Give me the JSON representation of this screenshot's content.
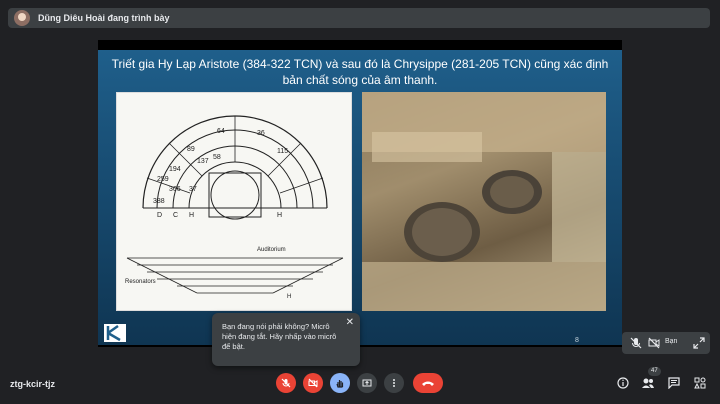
{
  "presenter": {
    "text": "Dũng Diêu Hoài đang trình bày"
  },
  "slide": {
    "title": "Triết gia Hy Lạp Aristote (384-322 TCN)  và sau đó là Chrysippe (281-205 TCN) cũng xác định bản chất sóng của âm thanh.",
    "page": "8"
  },
  "tooltip": {
    "text": "Bạn đang nói phải không? Micrô hiện đang tắt. Hãy nhấp vào micrô để bật."
  },
  "self_tile": {
    "name": "Bạn"
  },
  "meeting": {
    "code": "ztg-kcir-tjz",
    "participants": "47"
  },
  "icons": [
    "mic-off-icon",
    "camera-off-icon",
    "raise-hand-icon",
    "present-icon",
    "more-icon",
    "end-call-icon",
    "info-icon",
    "people-icon",
    "chat-icon",
    "activities-icon"
  ],
  "colors": {
    "end_call": "#ea4335",
    "raise_hand_active": "#8ab4f8",
    "bar_bg": "#202124"
  }
}
